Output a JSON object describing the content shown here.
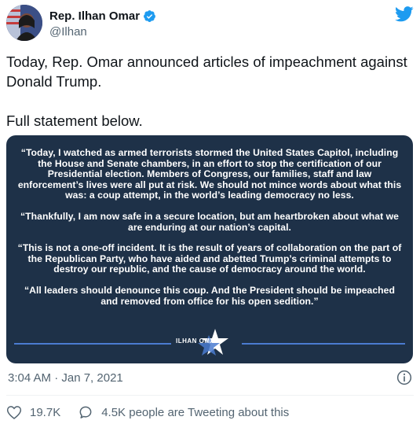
{
  "author": {
    "display_name": "Rep. Ilhan Omar",
    "handle": "@Ilhan",
    "verified": true
  },
  "tweet": {
    "text_lines": [
      "Today, Rep. Omar announced articles of impeachment against",
      "Donald Trump.",
      "Full statement below."
    ]
  },
  "card": {
    "paragraphs": [
      "“Today, I watched as armed terrorists stormed the United States Capitol, including the House and Senate chambers, in an effort to stop the certification of our Presidential election. Members of Congress, our families, staff and law enforcement’s lives were all put at risk. We should not mince words about what this was: a coup attempt, in the world’s leading democracy no less.",
      "“Thankfully, I am now safe in a secure location, but am heartbroken about what we are enduring at our nation’s capital.",
      "“This is not a one-off incident. It is the result of years of collaboration on the part of the Republican Party, who have aided and abetted Trump’s criminal attempts to destroy our republic, and the cause of democracy around the world.",
      "“All leaders should denounce this coup. And the President should be impeached and removed from office for his open sedition.”"
    ],
    "logo_text": "ILHAN OMAR",
    "colors": {
      "background": "#1e3148",
      "accent": "#4a7bd0"
    }
  },
  "meta": {
    "timestamp": "3:04 AM · Jan 7, 2021"
  },
  "actions": {
    "like_count": "19.7K",
    "comment_text": "4.5K people are Tweeting about this"
  },
  "icons": {
    "verified": "verified-badge-icon",
    "twitter": "twitter-bird-icon",
    "info": "info-icon",
    "like": "heart-icon",
    "comment": "comment-bubble-icon"
  }
}
